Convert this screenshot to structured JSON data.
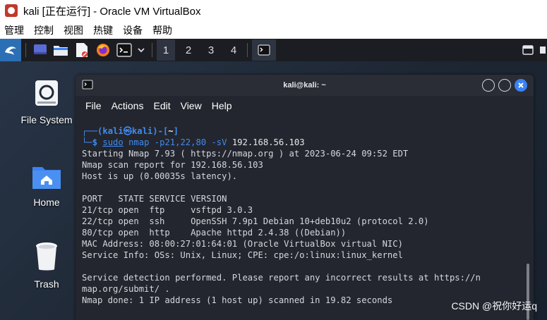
{
  "window": {
    "title": "kali [正在运行] - Oracle VM VirtualBox",
    "menu": [
      "管理",
      "控制",
      "视图",
      "热键",
      "设备",
      "帮助"
    ]
  },
  "panel": {
    "workspaces": [
      "1",
      "2",
      "3",
      "4"
    ],
    "active_workspace": "1"
  },
  "desktop": {
    "icons": [
      {
        "name": "File System",
        "icon": "drive-icon"
      },
      {
        "name": "Home",
        "icon": "home-folder-icon"
      },
      {
        "name": "Trash",
        "icon": "trash-icon"
      }
    ]
  },
  "terminal": {
    "title": "kali@kali: ~",
    "menu": [
      "File",
      "Actions",
      "Edit",
      "View",
      "Help"
    ],
    "prompt": {
      "line1_prefix": "┌──(",
      "user": "kali",
      "at_symbol": "㉿",
      "host": "kali",
      "line1_mid": ")-[",
      "path": "~",
      "line1_suffix": "]",
      "line2_prefix": "└─",
      "dollar": "$ ",
      "command": "sudo",
      "args": " nmap -p21,22,80 -sV ",
      "target": "192.168.56.103"
    },
    "output": [
      "Starting Nmap 7.93 ( https://nmap.org ) at 2023-06-24 09:52 EDT",
      "Nmap scan report for 192.168.56.103",
      "Host is up (0.00035s latency).",
      "",
      "PORT   STATE SERVICE VERSION",
      "21/tcp open  ftp     vsftpd 3.0.3",
      "22/tcp open  ssh     OpenSSH 7.9p1 Debian 10+deb10u2 (protocol 2.0)",
      "80/tcp open  http    Apache httpd 2.4.38 ((Debian))",
      "MAC Address: 08:00:27:01:64:01 (Oracle VirtualBox virtual NIC)",
      "Service Info: OSs: Unix, Linux; CPE: cpe:/o:linux:linux_kernel",
      "",
      "Service detection performed. Please report any incorrect results at https://n",
      "map.org/submit/ .",
      "Nmap done: 1 IP address (1 host up) scanned in 19.82 seconds"
    ]
  },
  "watermark": "CSDN @祝你好运q",
  "colors": {
    "panel_bg": "#1b1d22",
    "terminal_bg": "#23262e",
    "prompt_blue": "#3f8bf2",
    "close_button": "#3b82f6"
  }
}
